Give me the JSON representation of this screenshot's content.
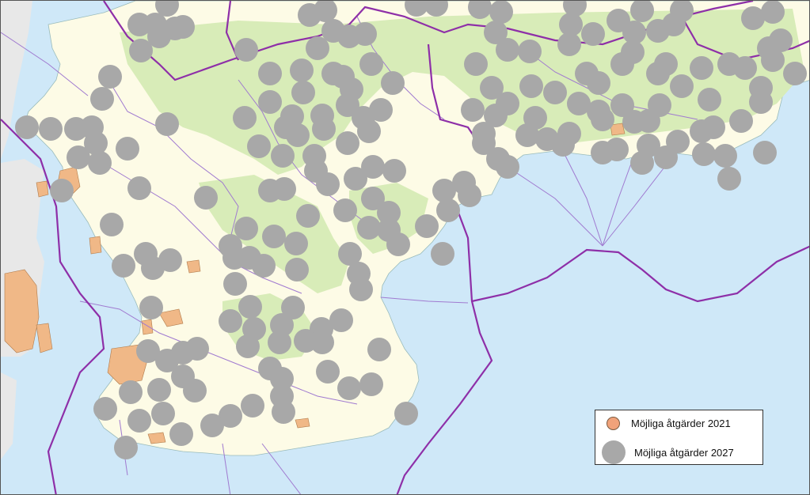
{
  "legend": {
    "items": [
      {
        "label": "Möjliga åtgärder 2021",
        "symbol": "small-orange-circle",
        "color": "#f0a27a"
      },
      {
        "label": "Möjliga åtgärder 2027",
        "symbol": "large-gray-circle",
        "color": "#a8a8a8"
      }
    ]
  },
  "colors": {
    "sea": "#cfe8f8",
    "land": "#fdfbe6",
    "forest": "#d8ecb8",
    "urban": "#f0b887",
    "county_border": "#8e2fa8",
    "municipal_border": "#a07ad0",
    "foreign_land": "#e8e8e8",
    "marker_2027": "#a8a8a8"
  },
  "markers_2027_count": 180
}
